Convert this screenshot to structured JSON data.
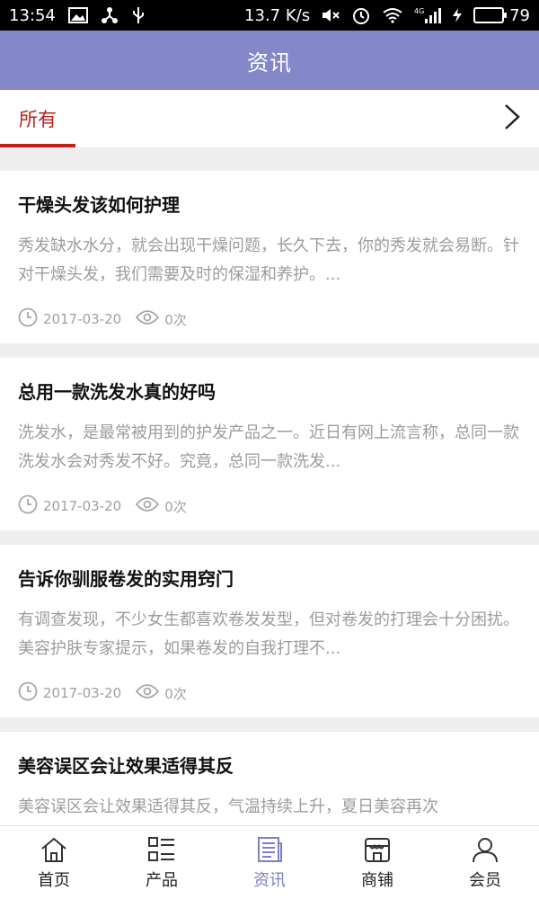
{
  "status_bar": {
    "time": "13:54",
    "speed": "13.7 K/s",
    "network": "4G",
    "battery_level": "79",
    "battery_fraction": 0.79,
    "battery_color": "#2ecc40"
  },
  "header": {
    "title": "资讯",
    "background": "#8488c9"
  },
  "tabs": {
    "active_label": "所有",
    "active_color": "#c2201b"
  },
  "articles": [
    {
      "title": "干燥头发该如何护理",
      "summary": "秀发缺水水分，就会出现干燥问题，长久下去，你的秀发就会易断。针对干燥头发，我们需要及时的保湿和养护。...",
      "date": "2017-03-20",
      "views": "0次"
    },
    {
      "title": "总用一款洗发水真的好吗",
      "summary": "洗发水，是最常被用到的护发产品之一。近日有网上流言称，总同一款洗发水会对秀发不好。究竟，总同一款洗发...",
      "date": "2017-03-20",
      "views": "0次"
    },
    {
      "title": "告诉你驯服卷发的实用窍门",
      "summary": "有调查发现，不少女生都喜欢卷发发型，但对卷发的打理会十分困扰。美容护肤专家提示，如果卷发的自我打理不...",
      "date": "2017-03-20",
      "views": "0次"
    },
    {
      "title": "美容误区会让效果适得其反",
      "summary": "美容误区会让效果适得其反，气温持续上升，夏日美容再次",
      "date": "",
      "views": ""
    }
  ],
  "bottom_nav": [
    {
      "label": "首页",
      "icon": "home-icon"
    },
    {
      "label": "产品",
      "icon": "product-grid-icon"
    },
    {
      "label": "资讯",
      "icon": "news-icon",
      "active": true
    },
    {
      "label": "商铺",
      "icon": "shop-icon"
    },
    {
      "label": "会员",
      "icon": "user-icon"
    }
  ]
}
